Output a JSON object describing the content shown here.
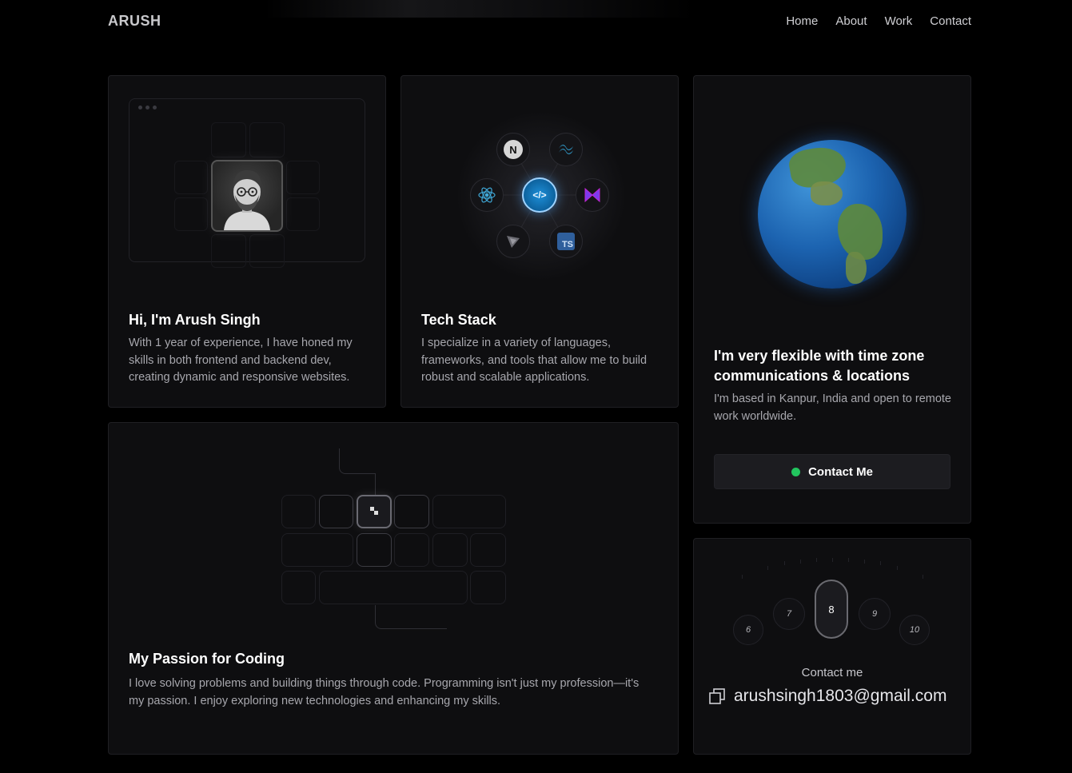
{
  "nav": {
    "logo": "ARUSH",
    "links": [
      "Home",
      "About",
      "Work",
      "Contact"
    ]
  },
  "intro": {
    "title": "Hi, I'm Arush Singh",
    "text": "With 1 year of experience, I have honed my skills in both frontend and backend dev, creating dynamic and responsive websites."
  },
  "tech": {
    "title": "Tech Stack",
    "text": "I specialize in a variety of languages, frameworks, and tools that allow me to build robust and scalable applications.",
    "icons": [
      "nextjs-icon",
      "tailwind-icon",
      "react-icon",
      "code-icon",
      "framer-icon",
      "vite-icon",
      "typescript-icon"
    ],
    "nextjs_label": "N",
    "ts_label": "TS",
    "center_label": "</>"
  },
  "globe": {
    "title": "I'm very flexible with time zone communications & locations",
    "text": "I'm based in Kanpur, India and open to remote work worldwide.",
    "button_label": "Contact Me",
    "status_color": "#22c55e"
  },
  "passion": {
    "title": "My Passion for Coding",
    "text": "I love solving problems and building things through code. Programming isn't just my profession—it's my passion. I enjoy exploring new technologies and enhancing my skills."
  },
  "contact": {
    "dial_numbers": [
      "6",
      "7",
      "8",
      "9",
      "10"
    ],
    "label": "Contact me",
    "email": "arushsingh1803@gmail.com"
  }
}
